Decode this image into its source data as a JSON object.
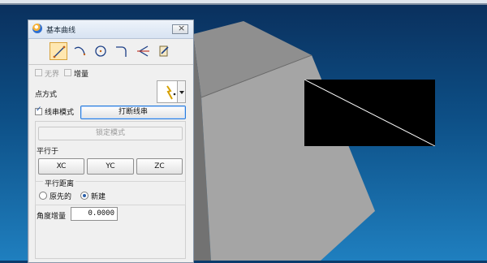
{
  "dialog": {
    "title": "基本曲线",
    "icons": [
      "line-icon",
      "arc-icon",
      "circle-icon",
      "fillet-icon",
      "trim-icon",
      "edit-curve-icon"
    ],
    "checkbox_infinite": "无界",
    "checkbox_increment": "增量",
    "point_method_label": "点方式",
    "string_mode_label": "线串模式",
    "break_string_button": "打断线串",
    "lock_mode_button": "锁定模式",
    "parallel_to_label": "平行于",
    "xc_button": "XC",
    "yc_button": "YC",
    "zc_button": "ZC",
    "parallel_distance_label": "平行距离",
    "radio_original": "原先的",
    "radio_new": "新建",
    "angle_increment_label": "角度增量",
    "angle_increment_value": "0.0000"
  },
  "colors": {
    "viewport_top": "#0a2f5c",
    "viewport_bottom": "#1f7fbf",
    "cube_face_left": "#7f7f7f",
    "cube_face_top": "#8f8f8f",
    "cube_face_front": "#a5a5a5",
    "preview_bg": "#000000",
    "preview_line": "#ffffff"
  }
}
